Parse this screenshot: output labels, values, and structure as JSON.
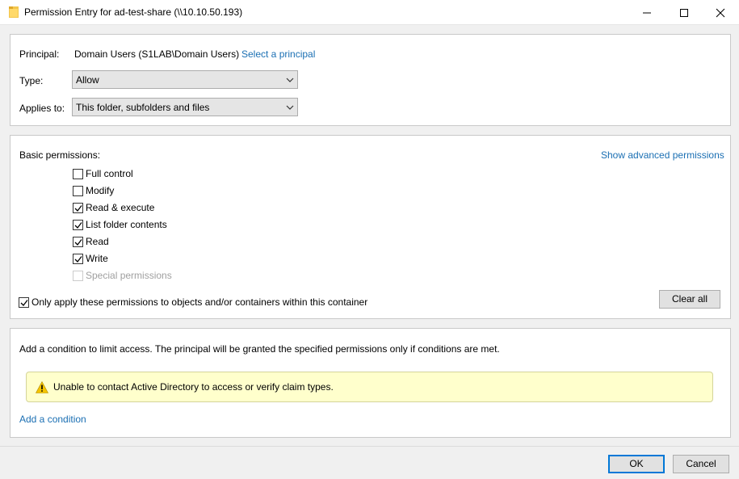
{
  "window": {
    "title": "Permission Entry for ad-test-share (\\\\10.10.50.193)",
    "icons": [
      "folder-icon",
      "minimize-icon",
      "maximize-icon",
      "close-icon"
    ]
  },
  "principal": {
    "label": "Principal:",
    "value": "Domain Users (S1LAB\\Domain Users)",
    "link": "Select a principal"
  },
  "type": {
    "label": "Type:",
    "selected": "Allow"
  },
  "applies_to": {
    "label": "Applies to:",
    "selected": "This folder, subfolders and files"
  },
  "permissions": {
    "heading": "Basic permissions:",
    "advanced_link": "Show advanced permissions",
    "items": [
      {
        "label": "Full control",
        "checked": false,
        "disabled": false
      },
      {
        "label": "Modify",
        "checked": false,
        "disabled": false
      },
      {
        "label": "Read & execute",
        "checked": true,
        "disabled": false
      },
      {
        "label": "List folder contents",
        "checked": true,
        "disabled": false
      },
      {
        "label": "Read",
        "checked": true,
        "disabled": false
      },
      {
        "label": "Write",
        "checked": true,
        "disabled": false
      },
      {
        "label": "Special permissions",
        "checked": false,
        "disabled": true
      }
    ],
    "only_apply": {
      "label": "Only apply these permissions to objects and/or containers within this container",
      "checked": true
    },
    "clear_all": "Clear all"
  },
  "condition": {
    "description": "Add a condition to limit access. The principal will be granted the specified permissions only if conditions are met.",
    "warning": "Unable to contact Active Directory to access or verify claim types.",
    "add_link": "Add a condition"
  },
  "footer": {
    "ok": "OK",
    "cancel": "Cancel"
  },
  "colors": {
    "link": "#1a6fb3",
    "warning_bg": "#ffffcc",
    "accent": "#0078d7"
  }
}
